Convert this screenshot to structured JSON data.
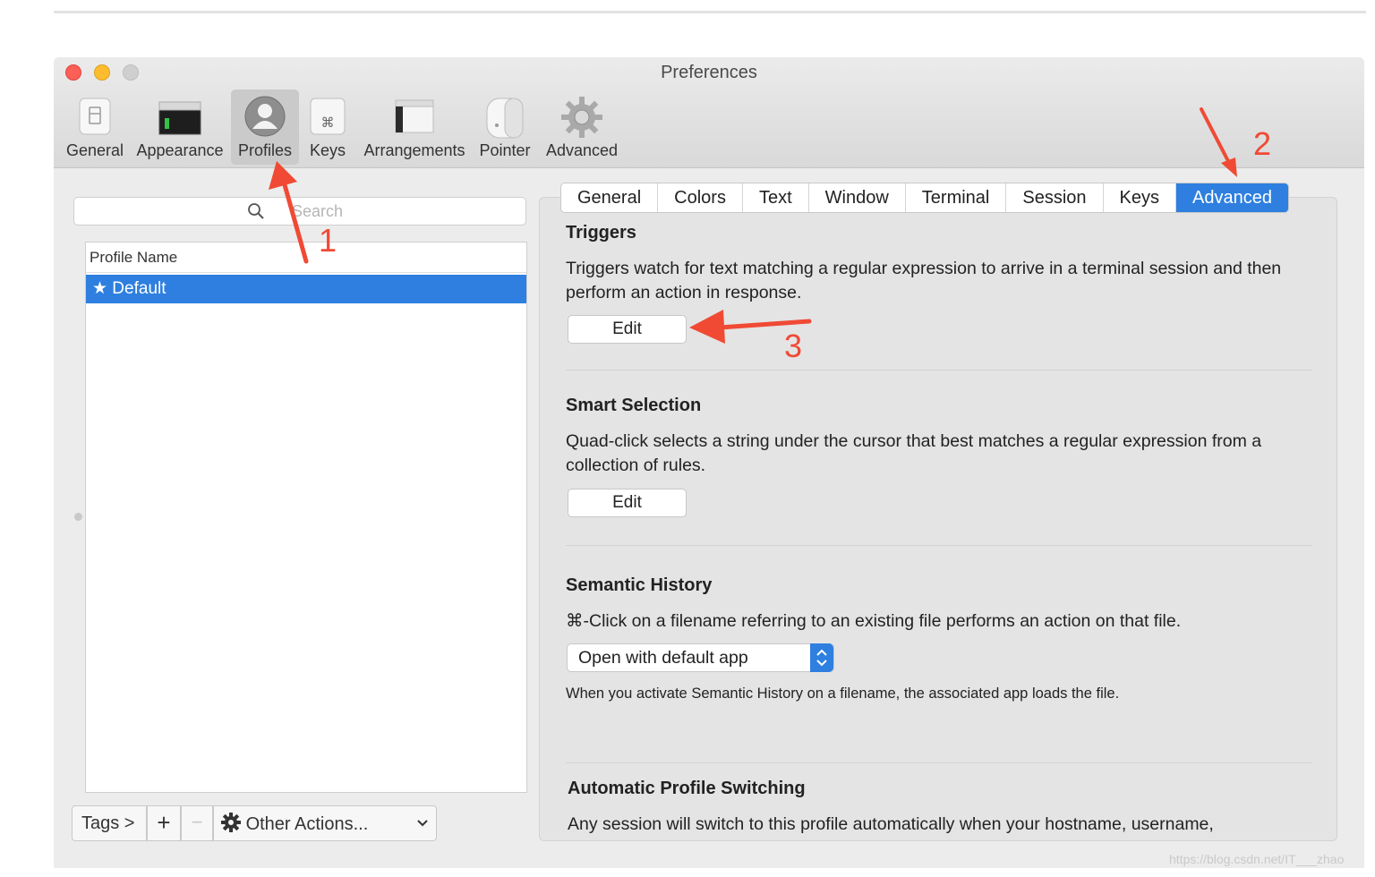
{
  "window": {
    "title": "Preferences"
  },
  "toolbar": {
    "items": [
      {
        "label": "General",
        "icon": "general-icon"
      },
      {
        "label": "Appearance",
        "icon": "appearance-icon"
      },
      {
        "label": "Profiles",
        "icon": "profiles-icon",
        "selected": true
      },
      {
        "label": "Keys",
        "icon": "keys-icon"
      },
      {
        "label": "Arrangements",
        "icon": "arrangements-icon"
      },
      {
        "label": "Pointer",
        "icon": "pointer-icon"
      },
      {
        "label": "Advanced",
        "icon": "advanced-icon"
      }
    ]
  },
  "sidebar": {
    "search_placeholder": "Search",
    "column_header": "Profile Name",
    "profiles": [
      {
        "label": "★ Default",
        "selected": true
      }
    ],
    "tags_label": "Tags >",
    "add_label": "+",
    "remove_label": "−",
    "actions_label": "Other Actions..."
  },
  "tabs": [
    {
      "label": "General"
    },
    {
      "label": "Colors"
    },
    {
      "label": "Text"
    },
    {
      "label": "Window"
    },
    {
      "label": "Terminal"
    },
    {
      "label": "Session"
    },
    {
      "label": "Keys"
    },
    {
      "label": "Advanced",
      "active": true
    }
  ],
  "triggers": {
    "title": "Triggers",
    "description": "Triggers watch for text matching a regular expression to arrive in a terminal session and then perform an action in response.",
    "button": "Edit"
  },
  "smart_selection": {
    "title": "Smart Selection",
    "description": "Quad-click selects a string under the cursor that best matches a regular expression from a collection of rules.",
    "button": "Edit"
  },
  "semantic_history": {
    "title": "Semantic History",
    "description": "⌘-Click on a filename referring to an existing file performs an action on that file.",
    "selected_option": "Open with default app",
    "note": "When you activate Semantic History on a filename, the associated app loads the file."
  },
  "auto_switching": {
    "title": "Automatic Profile Switching",
    "description": "Any session will switch to this profile automatically when your hostname, username,"
  },
  "annotations": {
    "labels": [
      "1",
      "2",
      "3"
    ],
    "color": "#f04a35"
  },
  "watermark": "https://blog.csdn.net/IT___zhao",
  "colors": {
    "accent": "#2e7fdf",
    "close": "#fc5f57",
    "minimize": "#fdbc2e",
    "zoom": "#cfcfcf"
  }
}
